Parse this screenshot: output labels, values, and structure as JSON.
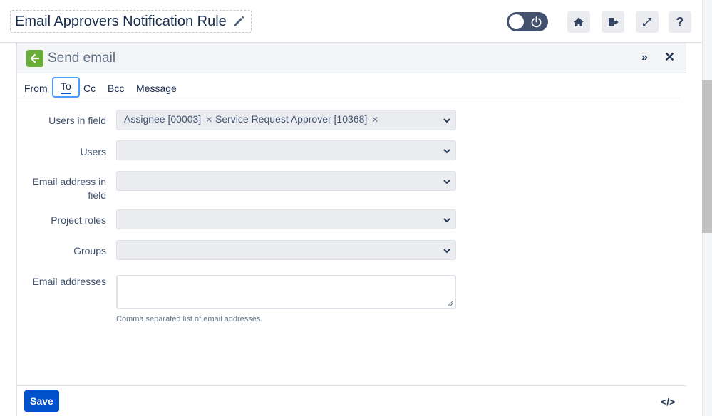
{
  "header": {
    "title": "Email Approvers Notification Rule",
    "buttons": [
      "home-icon",
      "export-icon",
      "expand-icon",
      "?"
    ]
  },
  "panel": {
    "title": "Send email",
    "expand_glyph": "»",
    "close_glyph": "✕"
  },
  "tabs": [
    {
      "label": "From"
    },
    {
      "label": "To"
    },
    {
      "label": "Cc"
    },
    {
      "label": "Bcc"
    },
    {
      "label": "Message"
    }
  ],
  "form": {
    "users_in_field": {
      "label": "Users in field",
      "chips": [
        "Assignee [00003]",
        "Service Request Approver [10368]"
      ],
      "remove_glyph": "✕"
    },
    "users": {
      "label": "Users"
    },
    "email_address_in_field": {
      "label_line1": "Email address in",
      "label_line2": "field"
    },
    "project_roles": {
      "label": "Project roles"
    },
    "groups": {
      "label": "Groups"
    },
    "email_addresses": {
      "label": "Email addresses",
      "hint": "Comma separated list of email addresses."
    }
  },
  "footer": {
    "save_label": "Save",
    "code_glyph": "</>"
  },
  "colors": {
    "primary": "#0052cc",
    "back_button": "#6aae3a",
    "toggle": "#42526e"
  }
}
